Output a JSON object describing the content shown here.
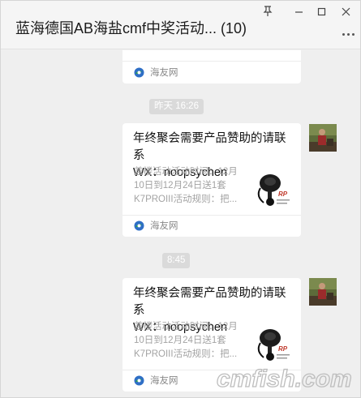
{
  "window": {
    "title": "蓝海德国AB海盐cmf中奖活动... (10)"
  },
  "chat": {
    "top_card": {
      "source": "海友网"
    },
    "timestamps": [
      "昨天 16:26",
      "8:45"
    ],
    "cards": [
      {
        "title_line1": "年终聚会需要产品赞助的请联系",
        "title_line2": "WX：noopsychen",
        "desc_line1": "盖楼活动活动时间：12月",
        "desc_line2": "10日到12月24日送1套",
        "desc_line3": "K7PROIII活动规则：把...",
        "thumb_brand": "RP",
        "source": "海友网"
      },
      {
        "title_line1": "年终聚会需要产品赞助的请联系",
        "title_line2": "WX：noopsychen",
        "desc_line1": "盖楼活动活动时间：12月",
        "desc_line2": "10日到12月24日送1套",
        "desc_line3": "K7PROIII活动规则：把...",
        "thumb_brand": "RP",
        "source": "海友网"
      }
    ]
  },
  "watermark": {
    "text": "cmfish.com"
  },
  "colors": {
    "background": "#efefef",
    "card": "#ffffff",
    "time_pill": "#dadada",
    "muted_text": "#a3a3a3",
    "source_icon_green": "#2ba245",
    "source_icon_blue": "#2f6fc6"
  },
  "icons": {
    "pin": "pin-icon",
    "minimize": "minimize-icon",
    "maximize": "maximize-icon",
    "close": "close-icon",
    "more": "more-icon",
    "source": "haiyou-logo-icon"
  }
}
